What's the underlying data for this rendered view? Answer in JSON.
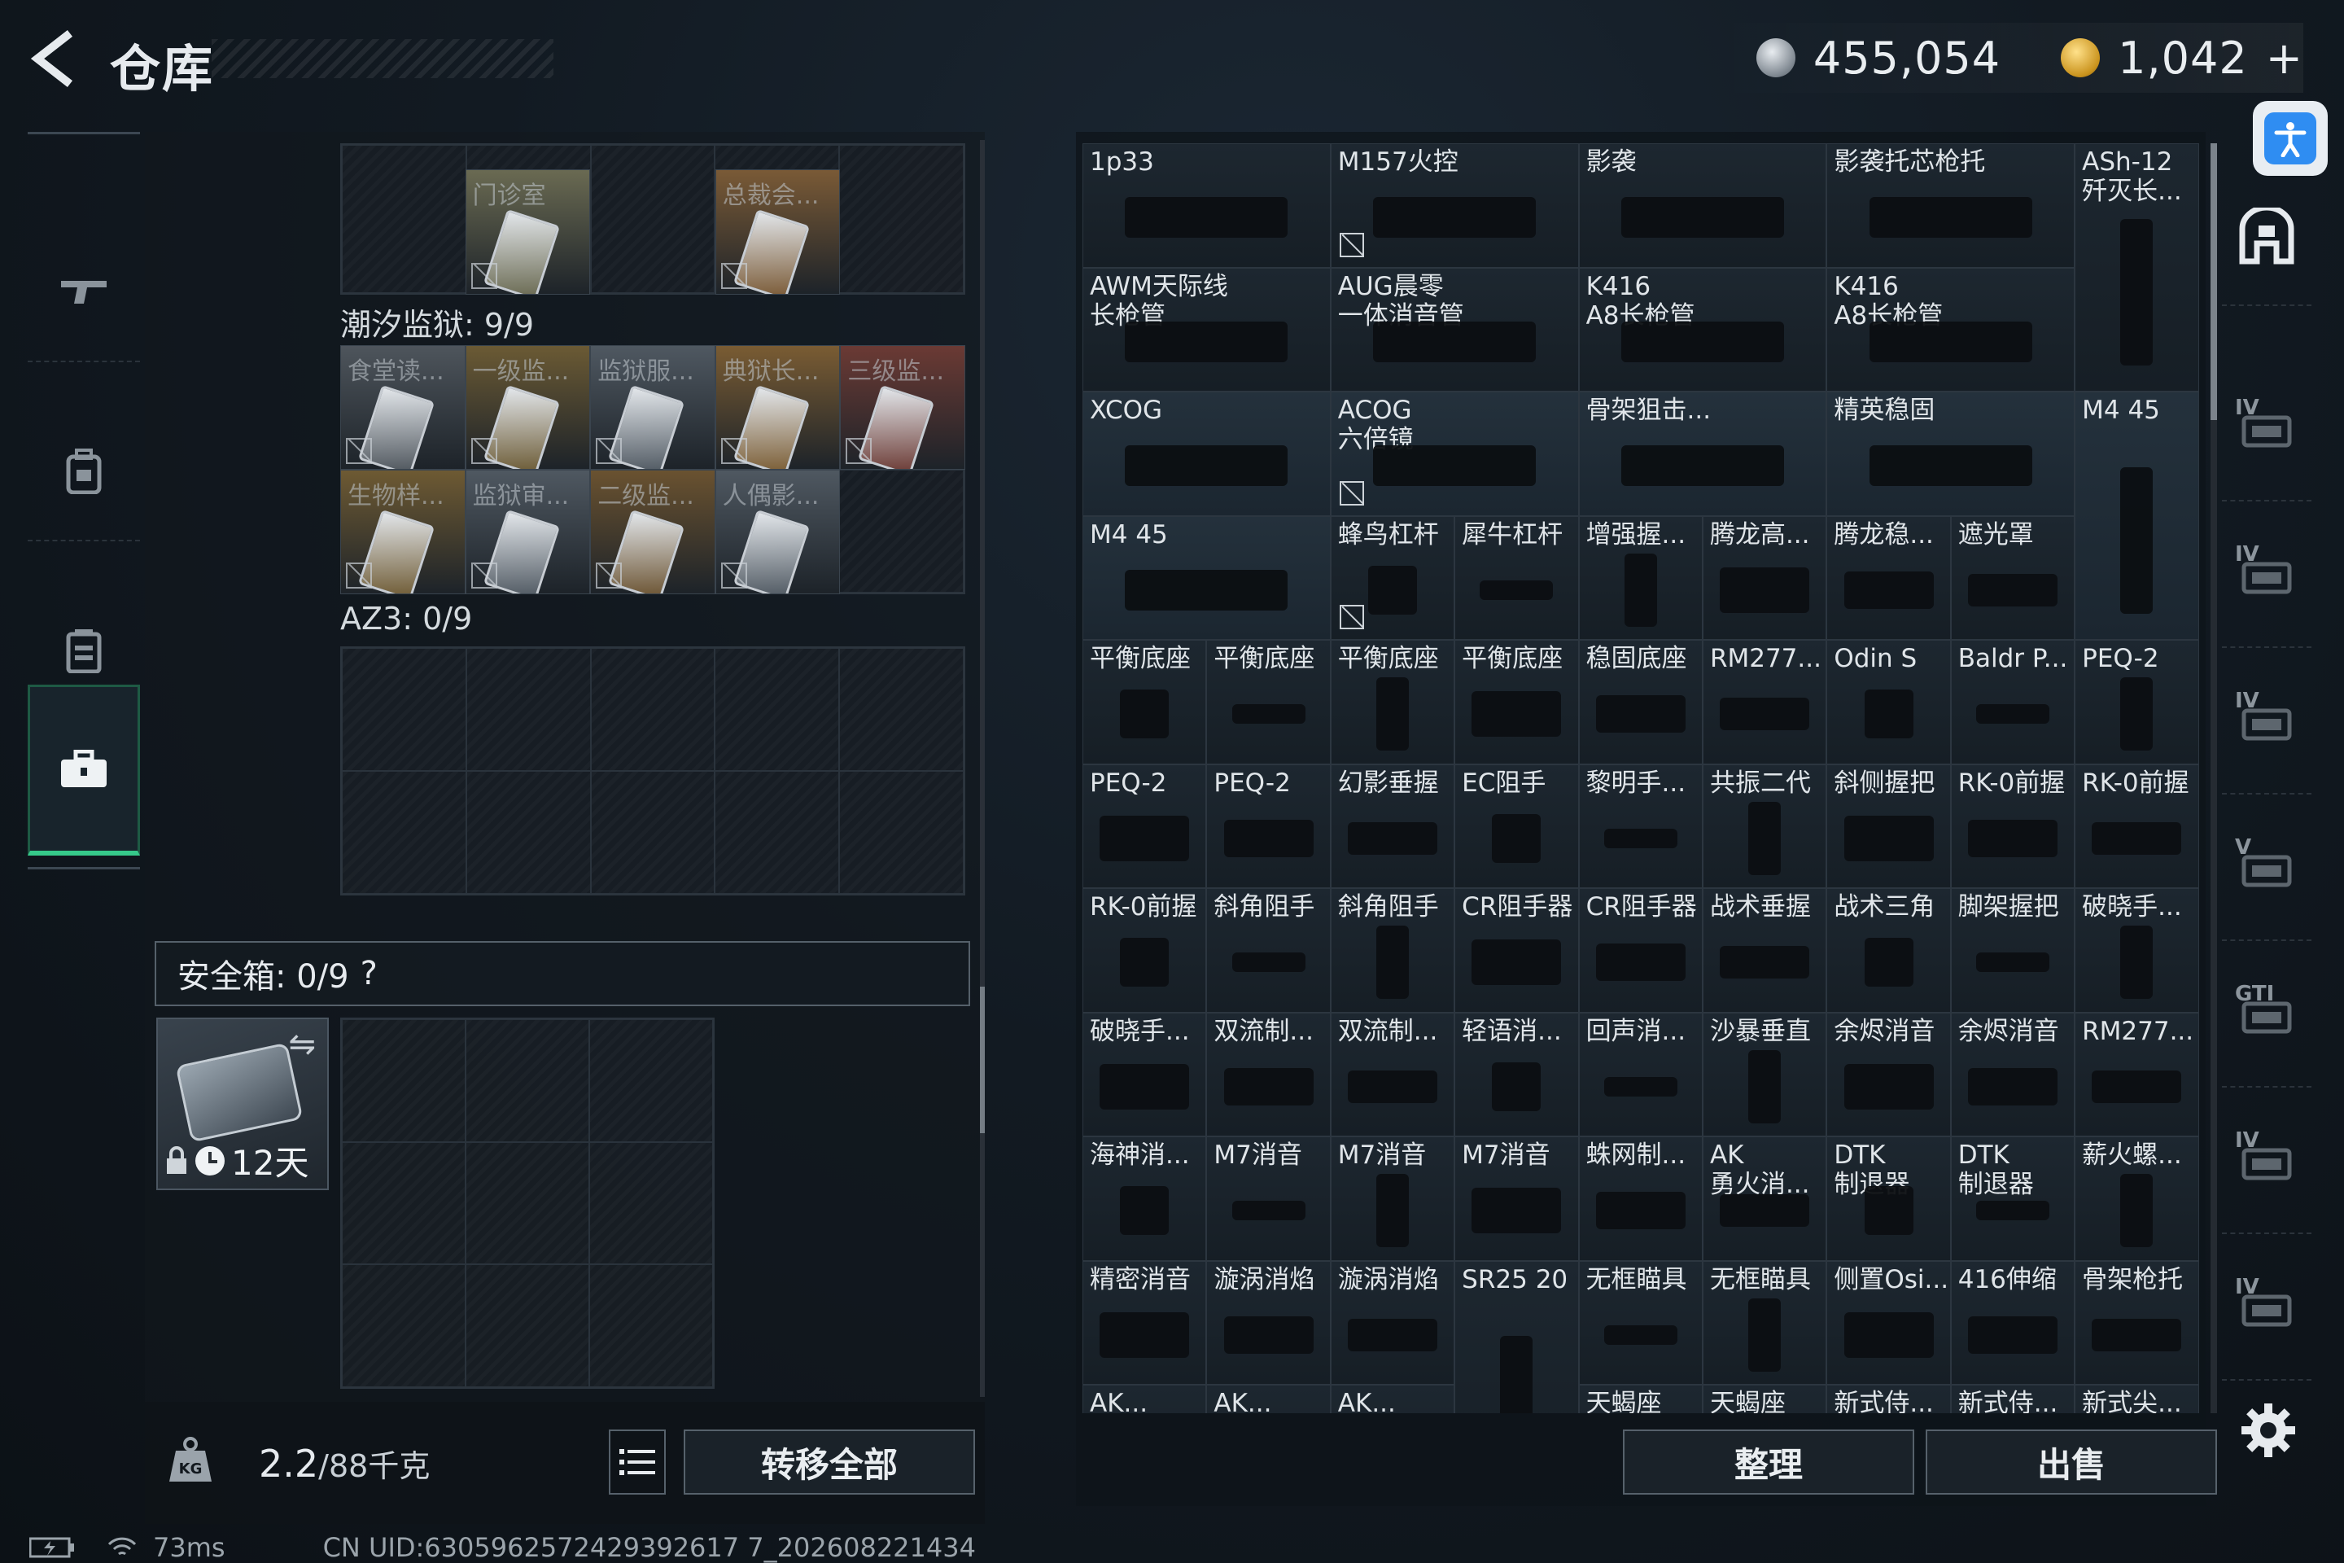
{
  "header": {
    "title": "仓库",
    "currency_silver": "455,054",
    "currency_gold": "1,042",
    "gold_plus": "+"
  },
  "nav": [
    {
      "icon": "gun-icon"
    },
    {
      "icon": "backpack-icon"
    },
    {
      "icon": "vest-icon"
    },
    {
      "icon": "toolbox-icon",
      "active": true
    }
  ],
  "sections": {
    "top_cards": [
      {
        "label": "门诊室",
        "color": "#6a6a52"
      },
      {
        "label": "总裁会...",
        "color": "#7a5a36"
      }
    ],
    "tide_prison": {
      "title": "潮汐监狱: 9/9",
      "cards": [
        {
          "label": "食堂读...",
          "color": "#4e555c"
        },
        {
          "label": "一级监...",
          "color": "#6b5a34"
        },
        {
          "label": "监狱服...",
          "color": "#4f5861"
        },
        {
          "label": "典狱长...",
          "color": "#7a5c33"
        },
        {
          "label": "三级监...",
          "color": "#6b3a34"
        },
        {
          "label": "生物样...",
          "color": "#6e5a33"
        },
        {
          "label": "监狱审...",
          "color": "#4f5861"
        },
        {
          "label": "二级监...",
          "color": "#6a5230"
        },
        {
          "label": "人偶影...",
          "color": "#4f5861"
        }
      ]
    },
    "az3": {
      "title": "AZ3: 0/9"
    },
    "safe_box": {
      "title": "安全箱: 0/9",
      "help": "?",
      "days": "12天"
    }
  },
  "footer_left": {
    "weight": "2.2",
    "weight_max": "/88千克",
    "transfer_all": "转移全部"
  },
  "status": {
    "ping": "73ms",
    "uid": "CN UID:6305962572429392617 7_202608221434"
  },
  "items": [
    {
      "name": "1p33",
      "size": "w2"
    },
    {
      "name": "M157火控",
      "size": "w2",
      "banned": true
    },
    {
      "name": "影袭",
      "size": "w2"
    },
    {
      "name": "影袭托芯枪托",
      "size": "w2"
    },
    {
      "name": "ASh-12\n歼灭长...",
      "size": "h2"
    },
    {
      "name": "AWM天际线\n长枪管",
      "size": "w2"
    },
    {
      "name": "AUG晨零\n一体消音管",
      "size": "w2"
    },
    {
      "name": "K416\nA8长枪管",
      "size": "w2"
    },
    {
      "name": "K416\nA8长枪管",
      "size": "w2"
    },
    {
      "name": "XCOG",
      "size": "w2",
      "tint": "blue"
    },
    {
      "name": "ACOG\n六倍镜",
      "size": "w2",
      "tint": "blue",
      "banned": true
    },
    {
      "name": "骨架狙击...",
      "size": "w2",
      "tint": "blue"
    },
    {
      "name": "精英稳固",
      "size": "w2",
      "tint": "blue"
    },
    {
      "name": "M4 45",
      "size": "h2",
      "tint": "blue"
    },
    {
      "name": "M4 45",
      "size": "w2",
      "tint": "blue"
    },
    {
      "name": "蜂鸟杠杆",
      "banned": true
    },
    {
      "name": "犀牛杠杆"
    },
    {
      "name": "增强握..."
    },
    {
      "name": "腾龙高..."
    },
    {
      "name": "腾龙稳..."
    },
    {
      "name": "遮光罩"
    },
    {
      "name": "平衡底座"
    },
    {
      "name": "平衡底座"
    },
    {
      "name": "平衡底座"
    },
    {
      "name": "平衡底座"
    },
    {
      "name": "稳固底座"
    },
    {
      "name": "RM277..."
    },
    {
      "name": "Odin S"
    },
    {
      "name": "Baldr P..."
    },
    {
      "name": "PEQ-2"
    },
    {
      "name": "PEQ-2"
    },
    {
      "name": "PEQ-2"
    },
    {
      "name": "幻影垂握"
    },
    {
      "name": "EC阻手"
    },
    {
      "name": "黎明手..."
    },
    {
      "name": "共振二代"
    },
    {
      "name": "斜侧握把"
    },
    {
      "name": "RK-0前握"
    },
    {
      "name": "RK-0前握"
    },
    {
      "name": "RK-0前握"
    },
    {
      "name": "斜角阻手"
    },
    {
      "name": "斜角阻手"
    },
    {
      "name": "CR阻手器"
    },
    {
      "name": "CR阻手器"
    },
    {
      "name": "战术垂握"
    },
    {
      "name": "战术三角"
    },
    {
      "name": "脚架握把"
    },
    {
      "name": "破晓手..."
    },
    {
      "name": "破晓手..."
    },
    {
      "name": "双流制..."
    },
    {
      "name": "双流制..."
    },
    {
      "name": "轻语消..."
    },
    {
      "name": "回声消..."
    },
    {
      "name": "沙暴垂直"
    },
    {
      "name": "余烬消音"
    },
    {
      "name": "余烬消音"
    },
    {
      "name": "RM277..."
    },
    {
      "name": "海神消..."
    },
    {
      "name": "M7消音"
    },
    {
      "name": "M7消音"
    },
    {
      "name": "M7消音"
    },
    {
      "name": "蛛网制..."
    },
    {
      "name": "AK\n勇火消..."
    },
    {
      "name": "DTK\n制退器"
    },
    {
      "name": "DTK\n制退器"
    },
    {
      "name": "薪火螺..."
    },
    {
      "name": "精密消音"
    },
    {
      "name": "漩涡消焰"
    },
    {
      "name": "漩涡消焰"
    },
    {
      "name": "SR25 20",
      "size": "h2",
      "banned": true
    },
    {
      "name": "无框瞄具"
    },
    {
      "name": "无框瞄具"
    },
    {
      "name": "侧置Osi..."
    },
    {
      "name": "416伸缩"
    },
    {
      "name": "骨架枪托"
    },
    {
      "name": "AK..."
    },
    {
      "name": "AK..."
    },
    {
      "name": "AK..."
    },
    {
      "name": "天蝎座"
    },
    {
      "name": "天蝎座"
    },
    {
      "name": "新式侍..."
    },
    {
      "name": "新式侍..."
    },
    {
      "name": "新式尖..."
    }
  ],
  "filters": [
    {
      "icon": "home-icon",
      "rank": ""
    },
    {
      "icon": "helmet-filter-icon",
      "rank": "IV"
    },
    {
      "icon": "armor-filter-icon",
      "rank": "IV"
    },
    {
      "icon": "backpack-filter-icon",
      "rank": "IV"
    },
    {
      "icon": "rig-filter-icon",
      "rank": "V"
    },
    {
      "icon": "mod-filter-icon",
      "rank": "GTI"
    },
    {
      "icon": "gun-filter-icon",
      "rank": "IV"
    },
    {
      "icon": "scope-filter-icon",
      "rank": "IV"
    }
  ],
  "footer_right": {
    "sort": "整理",
    "sell": "出售"
  }
}
